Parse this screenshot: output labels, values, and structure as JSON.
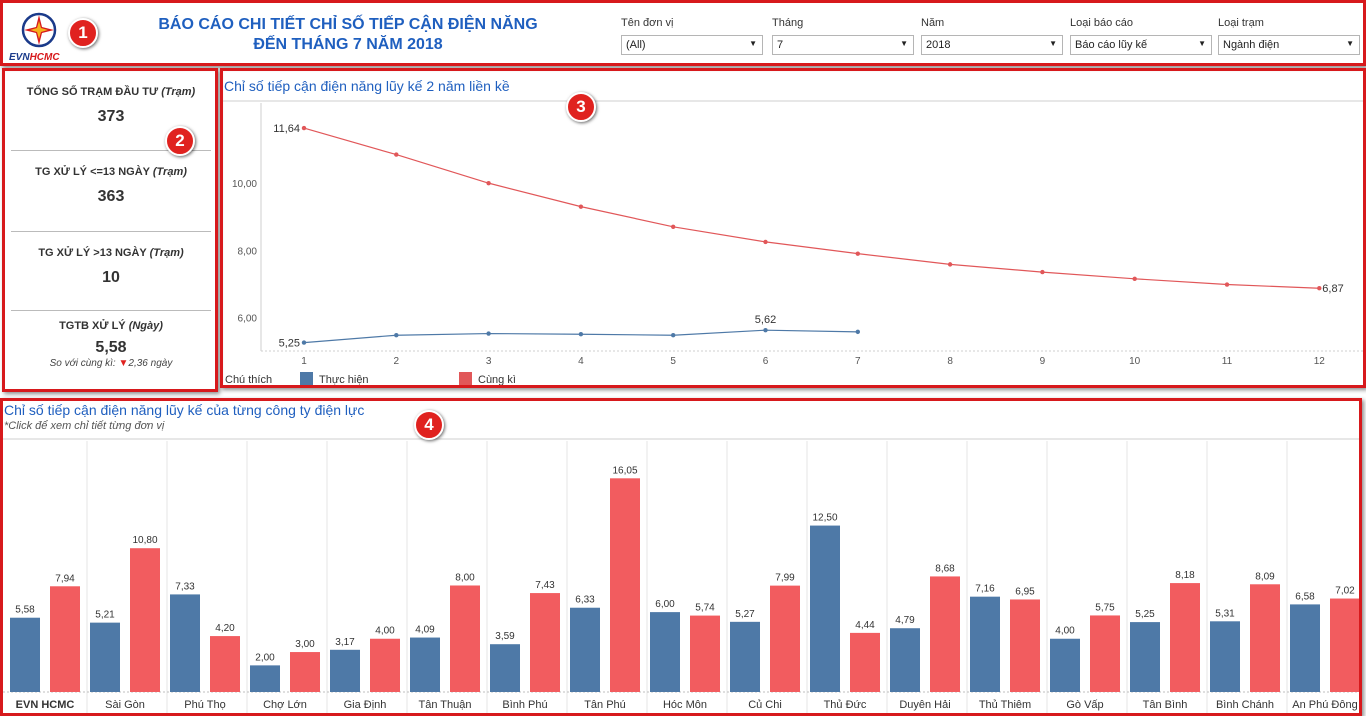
{
  "header": {
    "logo": {
      "evn": "EVN",
      "hcmc": "HCMC"
    },
    "title_line1": "BÁO CÁO CHI TIẾT CHỈ SỐ TIẾP CẬN ĐIỆN NĂNG",
    "title_line2": "ĐẾN THÁNG 7 NĂM 2018",
    "filters": [
      {
        "label": "Tên đơn vị",
        "value": "(All)"
      },
      {
        "label": "Tháng",
        "value": "7"
      },
      {
        "label": "Năm",
        "value": "2018"
      },
      {
        "label": "Loại báo cáo",
        "value": "Báo cáo lũy kế"
      },
      {
        "label": "Loại trạm",
        "value": "Ngành điện"
      }
    ]
  },
  "badges": [
    "1",
    "2",
    "3",
    "4"
  ],
  "kpis": [
    {
      "label": "TỔNG SỐ TRẠM ĐẦU TƯ",
      "unit": "(Trạm)",
      "value": "373"
    },
    {
      "label": "TG XỬ LÝ <=13 NGÀY",
      "unit": "(Trạm)",
      "value": "363"
    },
    {
      "label": "TG XỬ LÝ >13 NGÀY",
      "unit": "(Trạm)",
      "value": "10"
    },
    {
      "label": "TGTB XỬ LÝ",
      "unit": "(Ngày)",
      "value": "5,58",
      "sub_prefix": "So với cùng kì:",
      "sub_value": "2,36 ngày",
      "sub_icon": "down-triangle-icon"
    }
  ],
  "line_section": {
    "title": "Chỉ số tiếp cận điện năng lũy kế 2 năm liền kề",
    "legend_title": "Chú thích"
  },
  "bar_section": {
    "title": "Chỉ số tiếp cận điện năng lũy kế của từng công ty điện lực",
    "subtitle": "*Click để xem chỉ tiết từng đơn vị"
  },
  "colors": {
    "actual": "#4e79a7",
    "previous": "#f25c5f",
    "frame": "#d7191c",
    "title": "#1f5fbf"
  },
  "chart_data": [
    {
      "type": "line",
      "title": "Chỉ số tiếp cận điện năng lũy kế 2 năm liền kề",
      "x": [
        1,
        2,
        3,
        4,
        5,
        6,
        7,
        8,
        9,
        10,
        11,
        12
      ],
      "ylim": [
        5.0,
        12.0
      ],
      "yticks": [
        "6,00",
        "8,00",
        "10,00"
      ],
      "ytick_values": [
        6,
        8,
        10
      ],
      "grid": false,
      "legend_placement": "bottom-left",
      "series": [
        {
          "name": "Thực hiện",
          "color": "#4e79a7",
          "values": [
            5.25,
            5.47,
            5.52,
            5.5,
            5.47,
            5.62,
            5.57
          ],
          "labels": {
            "0": "5,25",
            "5": "5,62"
          }
        },
        {
          "name": "Cùng kì",
          "color": "#e15759",
          "values": [
            11.64,
            10.85,
            10.0,
            9.3,
            8.7,
            8.25,
            7.9,
            7.58,
            7.35,
            7.15,
            6.98,
            6.87
          ],
          "labels": {
            "0": "11,64",
            "11": "6,87"
          }
        }
      ]
    },
    {
      "type": "bar",
      "title": "Chỉ số tiếp cận điện năng lũy kế của từng công ty điện lực",
      "categories": [
        "EVN HCMC",
        "Sài Gòn",
        "Phú Thọ",
        "Chợ Lớn",
        "Gia Định",
        "Tân Thuận",
        "Bình Phú",
        "Tân Phú",
        "Hóc Môn",
        "Củ Chi",
        "Thủ Đức",
        "Duyên Hải",
        "Thủ Thiêm",
        "Gò Vấp",
        "Tân Bình",
        "Bình Chánh",
        "An Phú Đông"
      ],
      "ylim": [
        0,
        17.5
      ],
      "series": [
        {
          "name": "Thực hiện",
          "color": "#4e79a7",
          "values": [
            5.58,
            5.21,
            7.33,
            2.0,
            3.17,
            4.09,
            3.59,
            6.33,
            6.0,
            5.27,
            12.5,
            4.79,
            7.16,
            4.0,
            5.25,
            5.31,
            6.58
          ],
          "labels": [
            "5,58",
            "5,21",
            "7,33",
            "2,00",
            "3,17",
            "4,09",
            "3,59",
            "6,33",
            "6,00",
            "5,27",
            "12,50",
            "4,79",
            "7,16",
            "4,00",
            "5,25",
            "5,31",
            "6,58"
          ]
        },
        {
          "name": "Cùng kì",
          "color": "#f25c5f",
          "values": [
            7.94,
            10.8,
            4.2,
            3.0,
            4.0,
            8.0,
            7.43,
            16.05,
            5.74,
            7.99,
            4.44,
            8.68,
            6.95,
            5.75,
            8.18,
            8.09,
            7.02
          ],
          "labels": [
            "7,94",
            "10,80",
            "4,20",
            "3,00",
            "4,00",
            "8,00",
            "7,43",
            "16,05",
            "5,74",
            "7,99",
            "4,44",
            "8,68",
            "6,95",
            "5,75",
            "8,18",
            "8,09",
            "7,02"
          ]
        }
      ]
    }
  ]
}
